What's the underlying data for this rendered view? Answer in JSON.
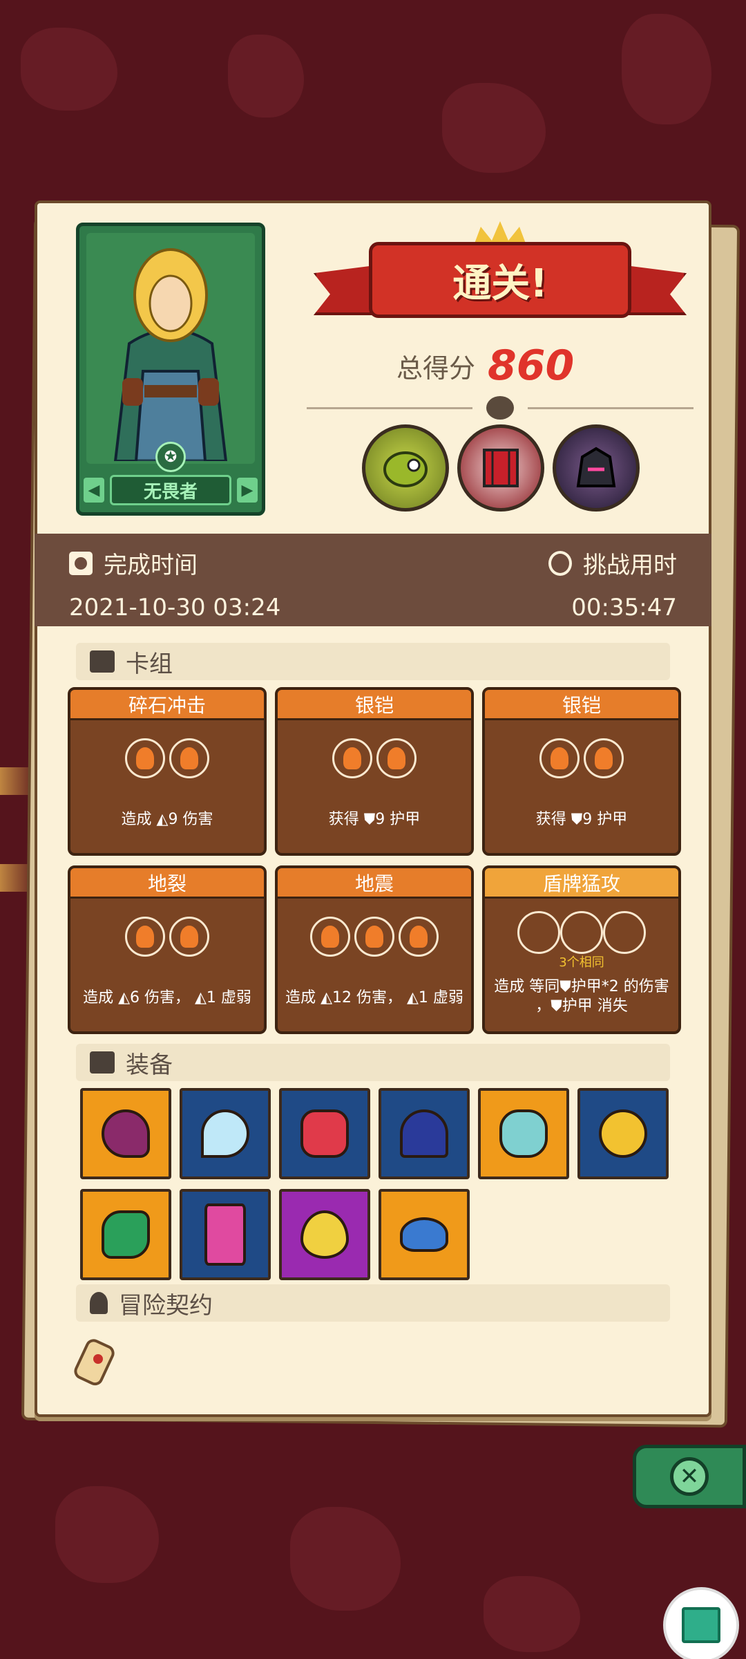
{
  "result": {
    "banner_text": "通关!",
    "score_label": "总得分",
    "score_value": "860"
  },
  "hero": {
    "name": "无畏者"
  },
  "info": {
    "finish_label": "完成时间",
    "finish_value": "2021-10-30 03:24",
    "duration_label": "挑战用时",
    "duration_value": "00:35:47"
  },
  "sections": {
    "deck": "卡组",
    "equipment": "装备",
    "contract": "冒险契约"
  },
  "cards": [
    {
      "title": "碎石冲击",
      "desc": "造成 ◭9 伤害",
      "sub": ""
    },
    {
      "title": "银铠",
      "desc": "获得 ⛊9 护甲",
      "sub": ""
    },
    {
      "title": "银铠",
      "desc": "获得 ⛊9 护甲",
      "sub": ""
    },
    {
      "title": "地裂",
      "desc": "造成 ◭6 伤害， ◭1 虚弱",
      "sub": ""
    },
    {
      "title": "地震",
      "desc": "造成 ◭12 伤害， ◭1 虚弱",
      "sub": ""
    },
    {
      "title": "盾牌猛攻",
      "desc": "造成 等同⛊护甲*2 的伤害 ，⛊护甲 消失",
      "sub": "3个相同"
    }
  ],
  "colors": {
    "background": "#55141c",
    "panel": "#fbf1d8",
    "card": "#7a4423",
    "card_header": "#e67d2a",
    "score": "#e0342b"
  }
}
